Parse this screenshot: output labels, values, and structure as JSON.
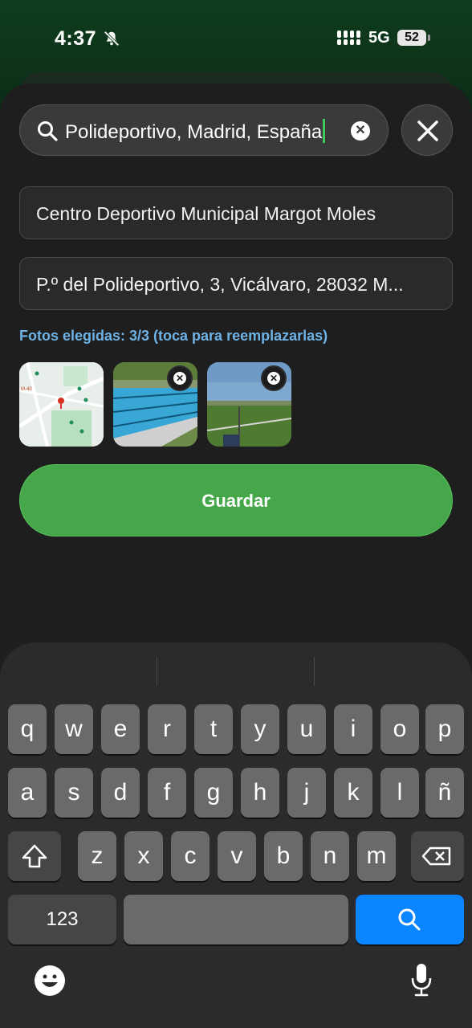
{
  "status_bar": {
    "time": "4:37",
    "network": "5G",
    "battery": "52"
  },
  "search": {
    "query": "Polideportivo, Madrid, España"
  },
  "form": {
    "name_field": "Centro Deportivo Municipal Margot Moles",
    "address_field": "P.º del Polideportivo, 3, Vicálvaro, 28032 M..."
  },
  "photos": {
    "label": "Fotos elegidas: 3/3 (toca para reemplazarlas)",
    "count": 3
  },
  "save_button": "Guardar",
  "keyboard": {
    "row1": [
      "q",
      "w",
      "e",
      "r",
      "t",
      "y",
      "u",
      "i",
      "o",
      "p"
    ],
    "row2": [
      "a",
      "s",
      "d",
      "f",
      "g",
      "h",
      "j",
      "k",
      "l",
      "ñ"
    ],
    "row3": [
      "z",
      "x",
      "c",
      "v",
      "b",
      "n",
      "m"
    ],
    "numbers_key": "123"
  },
  "colors": {
    "accent_green": "#45a64a",
    "label_blue": "#6fb3e6",
    "keyboard_blue": "#0a84ff"
  }
}
